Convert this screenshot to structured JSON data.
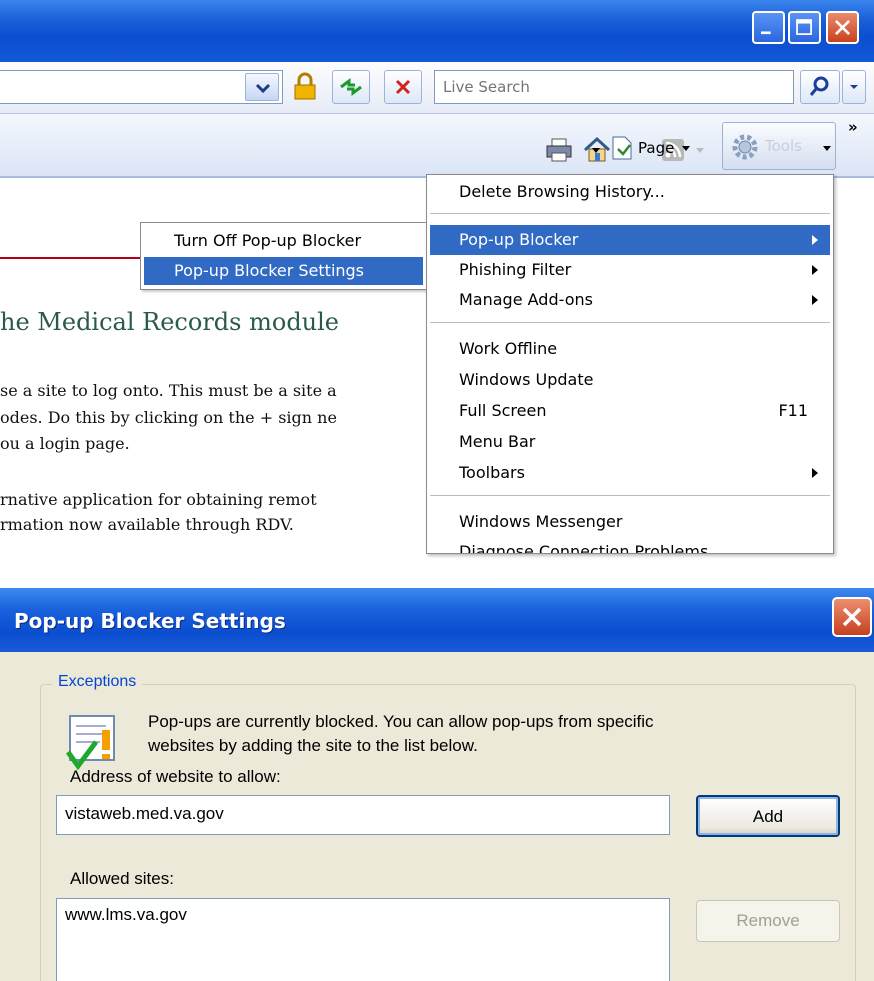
{
  "browser": {
    "search": {
      "placeholder": "Live Search"
    },
    "command_bar": {
      "page_label": "Page",
      "tools_label": "Tools",
      "more_label": "»"
    },
    "tools_menu": {
      "items": [
        {
          "label": "Delete Browsing History...",
          "mnemonic": "D"
        },
        {
          "label": "Pop-up Blocker",
          "mnemonic": "P",
          "submenu": true,
          "highlighted": true
        },
        {
          "label": "Phishing Filter",
          "mnemonic": "h",
          "submenu": true
        },
        {
          "label": "Manage Add-ons",
          "mnemonic": "A",
          "submenu": true
        },
        {
          "label": "Work Offline",
          "mnemonic": "W"
        },
        {
          "label": "Windows Update",
          "mnemonic": "U"
        },
        {
          "label": "Full Screen",
          "mnemonic": "F",
          "accelerator": "F11"
        },
        {
          "label": "Menu Bar",
          "mnemonic": "M"
        },
        {
          "label": "Toolbars",
          "mnemonic": "T",
          "submenu": true
        },
        {
          "label": "Windows Messenger"
        },
        {
          "label": "Diagnose Connection Problems"
        }
      ]
    },
    "popup_submenu": {
      "items": [
        {
          "label": "Turn Off Pop-up Blocker",
          "mnemonic": "B"
        },
        {
          "label": "Pop-up Blocker Settings",
          "mnemonic": "P",
          "highlighted": true
        }
      ]
    },
    "page": {
      "heading": "he Medical Records module",
      "lines": [
        "se a site to log onto. This must be a site a",
        "odes. Do this by clicking on the + sign ne",
        "ou a login page.",
        "rnative application for obtaining remot",
        "rmation now available through RDV."
      ]
    }
  },
  "dialog": {
    "title": "Pop-up Blocker Settings",
    "group_label": "Exceptions",
    "info_line1": "Pop-ups are currently blocked.  You can allow pop-ups from specific",
    "info_line2": "websites by adding the site to the list below.",
    "address_label": "Address of website to allow:",
    "address_value": "vistaweb.med.va.gov",
    "add_button": "Add",
    "allowed_label": "Allowed sites:",
    "allowed_sites": [
      "www.lms.va.gov"
    ],
    "remove_button": "Remove"
  },
  "colors": {
    "title_blue": "#0b4fd0",
    "menu_highlight": "#316ac5",
    "dialog_face": "#ece9d8",
    "heading_green": "#2a5a4a",
    "group_label_blue": "#0046d5"
  }
}
